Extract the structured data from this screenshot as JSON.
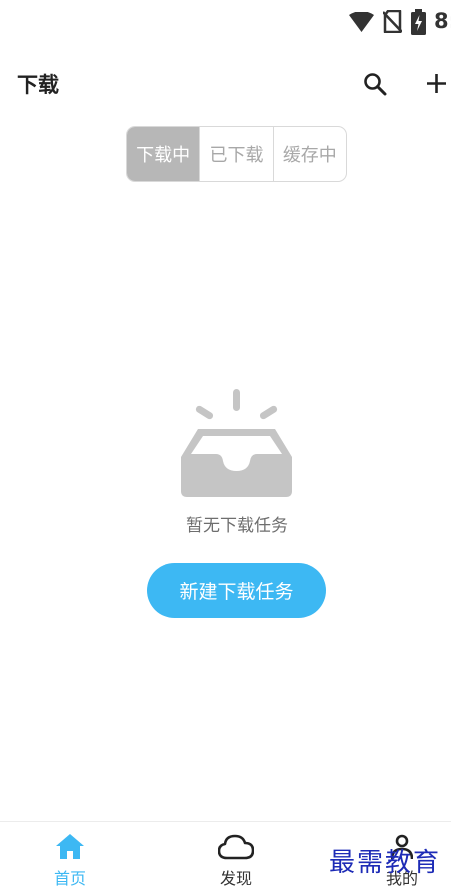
{
  "status_bar": {
    "time": "8:",
    "icons": [
      "wifi-icon",
      "no-sim-icon",
      "battery-charging-icon"
    ]
  },
  "header": {
    "title": "下载",
    "actions": [
      "search-icon",
      "add-icon"
    ]
  },
  "tabs": [
    {
      "label": "下载中",
      "active": true
    },
    {
      "label": "已下载",
      "active": false
    },
    {
      "label": "缓存中",
      "active": false
    }
  ],
  "empty_state": {
    "icon": "empty-inbox-icon",
    "message": "暂无下载任务",
    "button_label": "新建下载任务"
  },
  "bottom_nav": {
    "items": [
      {
        "label": "首页",
        "icon": "home-icon",
        "active": true
      },
      {
        "label": "发现",
        "icon": "cloud-icon",
        "active": false
      },
      {
        "label": "我的",
        "icon": "person-icon",
        "active": false
      }
    ]
  },
  "watermark": "最需教育",
  "colors": {
    "accent": "#3db8f3",
    "active_tab_bg": "#b7b7b7",
    "inactive_tab_text": "#a8a8a8",
    "illustration": "#c5c5c5",
    "watermark": "#1d2bb6"
  }
}
